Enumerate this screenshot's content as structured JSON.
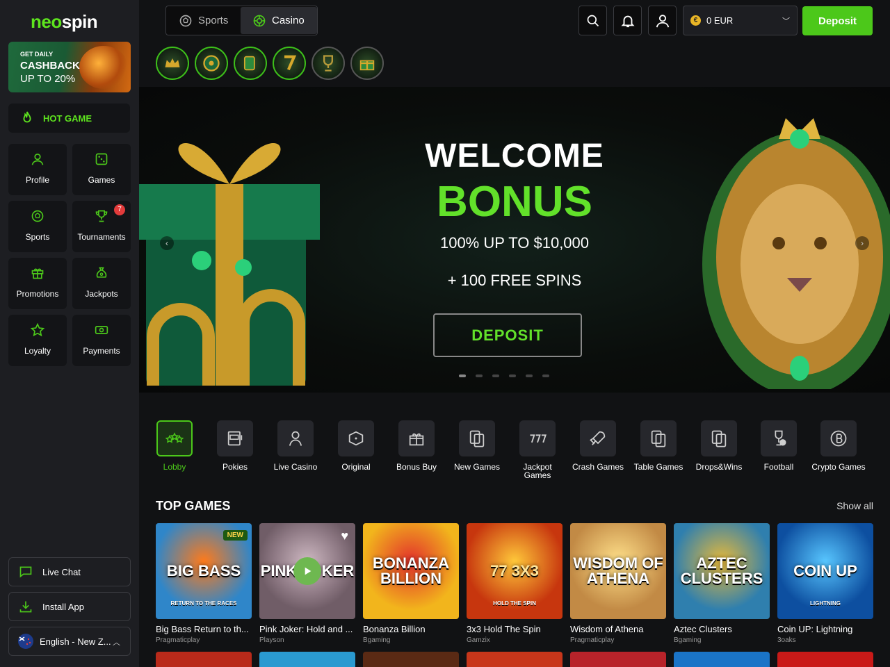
{
  "brand": {
    "logo_a": "neo",
    "logo_b": "spin"
  },
  "sidebar": {
    "promo": {
      "line1": "GET DAILY",
      "line2": "CASHBACK",
      "line3": "UP TO 20%"
    },
    "hot_game": "HOT GAME",
    "tiles": [
      {
        "label": "Profile",
        "icon": "user-icon"
      },
      {
        "label": "Games",
        "icon": "dice-icon"
      },
      {
        "label": "Sports",
        "icon": "soccer-ball-icon"
      },
      {
        "label": "Tournaments",
        "icon": "trophy-icon",
        "badge": "7"
      },
      {
        "label": "Promotions",
        "icon": "gift-icon"
      },
      {
        "label": "Jackpots",
        "icon": "money-bag-icon"
      },
      {
        "label": "Loyalty",
        "icon": "star-icon"
      },
      {
        "label": "Payments",
        "icon": "cash-icon"
      }
    ],
    "live_chat": "Live Chat",
    "install_app": "Install App",
    "language": "English - New Z..."
  },
  "topbar": {
    "sports_tab": "Sports",
    "casino_tab": "Casino",
    "balance": "0 EUR",
    "currency_symbol": "€",
    "deposit": "Deposit"
  },
  "hero": {
    "line1": "WELCOME",
    "line2": "BONUS",
    "line3": "100% UP TO $10,000",
    "line4": "+ 100 FREE SPINS",
    "cta": "DEPOSIT",
    "slide_count": 6,
    "active_slide": 1
  },
  "categories": [
    {
      "label": "Lobby",
      "icon": "stars-icon",
      "active": true
    },
    {
      "label": "Pokies",
      "icon": "slot-machine-icon"
    },
    {
      "label": "Live Casino",
      "icon": "dealer-icon"
    },
    {
      "label": "Original",
      "icon": "dice-cube-icon"
    },
    {
      "label": "Bonus Buy",
      "icon": "gift-box-icon"
    },
    {
      "label": "New Games",
      "icon": "cards-icon"
    },
    {
      "label": "Jackpot Games",
      "icon": "777-icon"
    },
    {
      "label": "Crash Games",
      "icon": "rocket-icon"
    },
    {
      "label": "Table Games",
      "icon": "cards-icon"
    },
    {
      "label": "Drops&Wins",
      "icon": "cards-icon"
    },
    {
      "label": "Football",
      "icon": "football-trophy-icon"
    },
    {
      "label": "Crypto Games",
      "icon": "bitcoin-icon"
    }
  ],
  "top_games": {
    "title": "TOP GAMES",
    "show_all": "Show all",
    "new_tag": "NEW",
    "items": [
      {
        "name": "Big Bass Return to th...",
        "provider": "Pragmaticplay",
        "art": "BIG BASS",
        "art_sub": "RETURN TO THE RACES",
        "bg": "#2f86c9",
        "accent": "#ff7a1a",
        "new": true
      },
      {
        "name": "Pink Joker: Hold and ...",
        "provider": "Playson",
        "art": "PINK JOKER",
        "art_sub": "",
        "bg": "#7a5a6a",
        "accent": "#d9b3c6",
        "hover": true
      },
      {
        "name": "Bonanza Billion",
        "provider": "Bgaming",
        "art": "BONANZA BILLION",
        "art_sub": "",
        "bg": "#f2b51c",
        "accent": "#e2322c"
      },
      {
        "name": "3x3 Hold The Spin",
        "provider": "Gamzix",
        "art": "77 3X3",
        "art_sub": "HOLD THE SPIN",
        "bg": "#c7360e",
        "accent": "#ffc83a"
      },
      {
        "name": "Wisdom of Athena",
        "provider": "Pragmaticplay",
        "art": "WISDOM OF ATHENA",
        "art_sub": "",
        "bg": "#c28a45",
        "accent": "#ffe08a"
      },
      {
        "name": "Aztec Clusters",
        "provider": "Bgaming",
        "art": "AZTEC CLUSTERS",
        "art_sub": "",
        "bg": "#2f7fae",
        "accent": "#e7b93a"
      },
      {
        "name": "Coin UP: Lightning",
        "provider": "3oaks",
        "art": "COIN UP",
        "art_sub": "LIGHTNING",
        "bg": "#0d4fa0",
        "accent": "#58c6ff"
      }
    ],
    "row2_colors": [
      "#b92a1a",
      "#2a9ad0",
      "#5a2a14",
      "#c8361a",
      "#b8232a",
      "#1a74c7",
      "#c91a18"
    ]
  }
}
